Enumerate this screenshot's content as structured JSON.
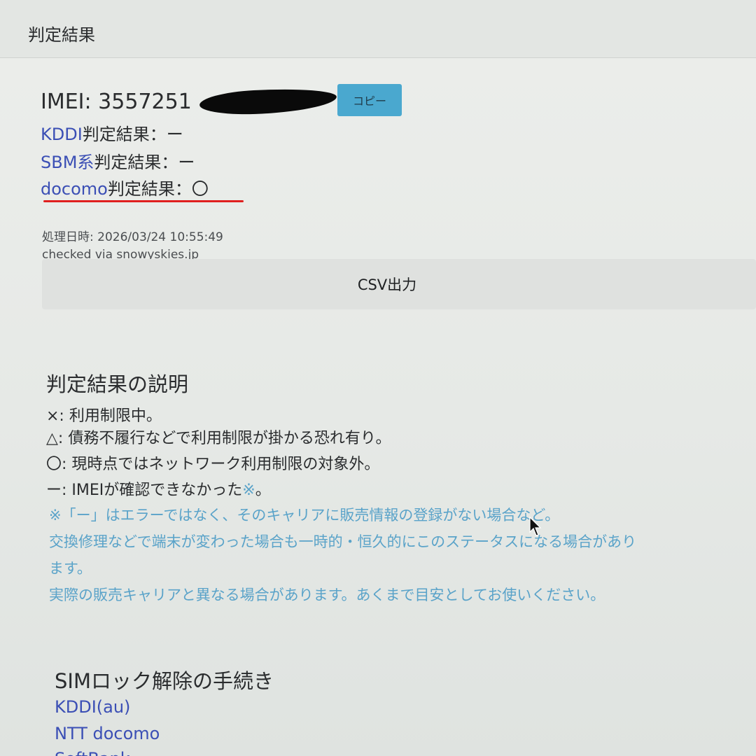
{
  "card": {
    "title": "判定結果"
  },
  "imei": {
    "label_value": "IMEI: 3557251",
    "copy_button": "コピー"
  },
  "results": [
    {
      "carrier": "KDDI",
      "suffix": "判定結果：ー"
    },
    {
      "carrier": "SBM系",
      "suffix": "判定結果：ー"
    },
    {
      "carrier": "docomo",
      "suffix": "判定結果：〇"
    }
  ],
  "meta": {
    "processed_at": "処理日時: 2026/03/24 10:55:49",
    "checked_via": "checked via snowyskies.jp"
  },
  "csv_button": "CSV出力",
  "explanation": {
    "heading": "判定結果の説明",
    "legend": [
      "×: 利用制限中。",
      "△: 債務不履行などで利用制限が掛かる恐れ有り。",
      "〇: 現時点ではネットワーク利用制限の対象外。"
    ],
    "dash_line": "ー: IMEIが確認できなかった",
    "dash_note_mark": "※",
    "dash_end": "。",
    "notes": [
      "※「ー」はエラーではなく、そのキャリアに販売情報の登録がない場合など。",
      "交換修理などで端末が変わった場合も一時的・恒久的にこのステータスになる場合があり",
      "ます。",
      "実際の販売キャリアと異なる場合があります。あくまで目安としてお使いください。"
    ]
  },
  "simlock": {
    "heading": "SIMロック解除の手続き",
    "links": [
      "KDDI(au)",
      "NTT docomo",
      "SoftBank"
    ]
  }
}
